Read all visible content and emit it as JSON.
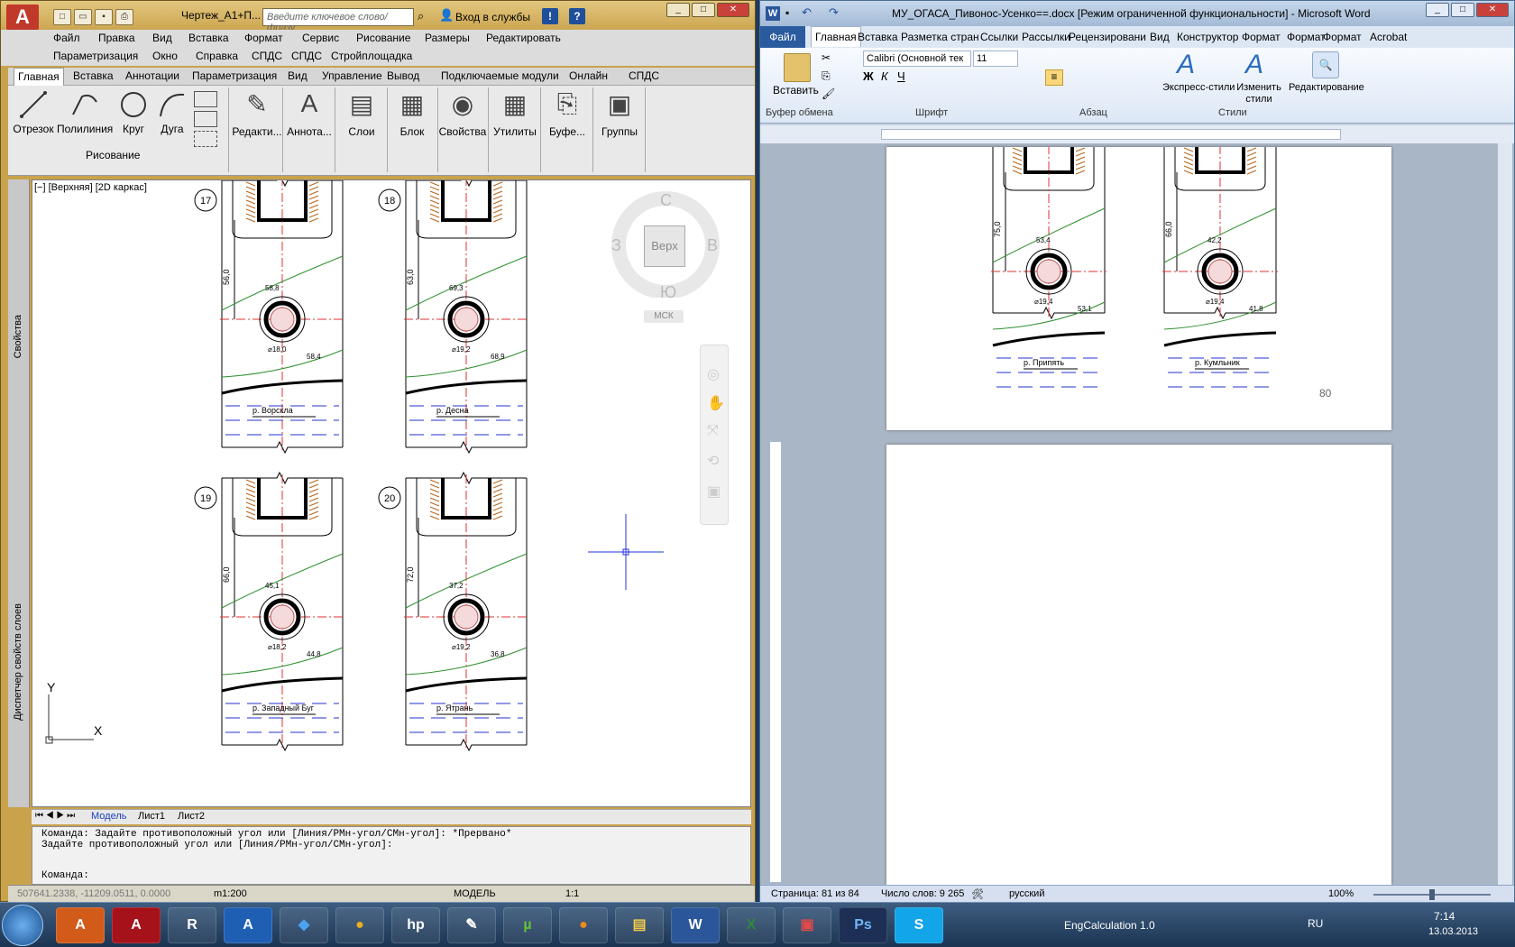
{
  "acad": {
    "title": "Чертеж_А1+П...",
    "search_placeholder": "Введите ключевое слово/фразу",
    "login": "Вход в службы",
    "menu_row1": [
      "Файл",
      "Правка",
      "Вид",
      "Вставка",
      "Формат",
      "Сервис",
      "Рисование",
      "Размеры",
      "Редактировать"
    ],
    "menu_row2": [
      "Параметризация",
      "Окно",
      "Справка",
      "СПДС",
      "СПДС",
      "Стройплощадка"
    ],
    "ribbon_tabs": [
      "Главная",
      "Вставка",
      "Аннотации",
      "Параметризация",
      "Вид",
      "Управление",
      "Вывод",
      "Подключаемые модули",
      "Онлайн",
      "СПДС"
    ],
    "tools": {
      "line": "Отрезок",
      "polyline": "Полилиния",
      "circle": "Круг",
      "arc": "Дуга"
    },
    "panels": [
      "Редакти...",
      "Аннота...",
      "Слои",
      "Блок",
      "Свойства",
      "Утилиты",
      "Буфе...",
      "Группы"
    ],
    "draw_panel_label": "Рисование",
    "viewport_label": "[−] [Верхняя] [2D каркас]",
    "viewcube": {
      "n": "С",
      "s": "Ю",
      "w": "З",
      "e": "В",
      "face": "Верх",
      "ucs": "МСК"
    },
    "drawings": [
      {
        "num": "17",
        "depth": "56,0",
        "upper": "58,8",
        "lower": "58,4",
        "dia": "⌀18,0",
        "river": "р. Ворскла"
      },
      {
        "num": "18",
        "depth": "63,0",
        "upper": "69,3",
        "lower": "68,9",
        "dia": "⌀19,2",
        "river": "р. Десна"
      },
      {
        "num": "19",
        "depth": "66,0",
        "upper": "45,1",
        "lower": "44,8",
        "dia": "⌀18,2",
        "river": "р. Западный Буг"
      },
      {
        "num": "20",
        "depth": "72,0",
        "upper": "37,2",
        "lower": "36,8",
        "dia": "⌀19,2",
        "river": "р. Ятрань"
      }
    ],
    "layout_tabs": [
      "Модель",
      "Лист1",
      "Лист2"
    ],
    "side_labels": [
      "Свойства",
      "Диспетчер свойств слоев"
    ],
    "cmd_lines": [
      "Команда: Задайте противоположный угол или [Линия/РМн-угол/СМн-угол]: *Прервано*",
      "Задайте противоположный угол или [Линия/РМн-угол/СМн-угол]:"
    ],
    "cmd_prompt": "Команда:",
    "coords": "507641.2338, -11209.0511, 0.0000",
    "scale": "m1:200",
    "model": "МОДЕЛЬ",
    "anno_scale": "1:1",
    "axes": {
      "y": "Y",
      "x": "X"
    }
  },
  "word": {
    "title": "МУ_ОГАСА_Пивонос-Усенко==.docx [Режим ограниченной функциональности] - Microsoft Word",
    "tabs": [
      "Файл",
      "Главная",
      "Вставка",
      "Разметка стран",
      "Ссылки",
      "Рассылки",
      "Рецензировани",
      "Вид",
      "Конструктор",
      "Формат",
      "Формат",
      "Формат",
      "Acrobat"
    ],
    "font": "Calibri (Основной тек",
    "size": "11",
    "paste": "Вставить",
    "express": "Экспресс-стили",
    "change": "Изменить стили",
    "editing": "Редактирование",
    "groups": [
      "Буфер обмена",
      "Шрифт",
      "Абзац",
      "Стили"
    ],
    "drawings": [
      {
        "depth": "75,0",
        "upper": "53,4",
        "lower": "53,1",
        "dia": "⌀19,4",
        "river": "р. Припять"
      },
      {
        "depth": "66,0",
        "upper": "42,2",
        "lower": "41,8",
        "dia": "⌀19,4",
        "river": "р. Кумльник"
      }
    ],
    "page_number": "80",
    "status_page": "Страница: 81 из 84",
    "status_words": "Число слов: 9 265",
    "status_lang": "русский",
    "zoom": "100%"
  },
  "taskbar": {
    "app_label": "EngCalculation 1.0",
    "lang": "RU",
    "time": "7:14",
    "date": "13.03.2013"
  }
}
